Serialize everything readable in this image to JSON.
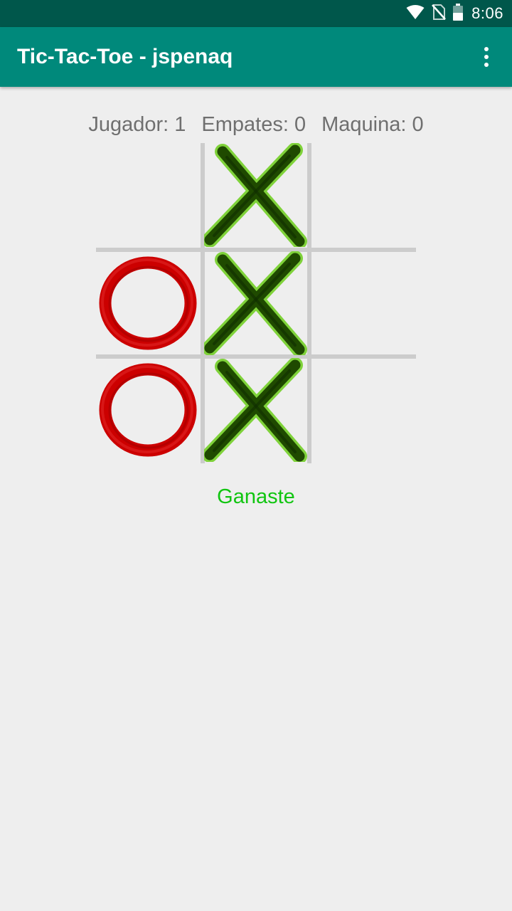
{
  "status_bar": {
    "time": "8:06",
    "icons": [
      "wifi-icon",
      "no-sim-icon",
      "battery-icon"
    ]
  },
  "app_bar": {
    "title": "Tic-Tac-Toe - jspenaq",
    "menu_icon": "more-vert-icon"
  },
  "scores": {
    "player": "Jugador: 1",
    "ties": "Empates: 0",
    "machine": "Maquina: 0"
  },
  "board": {
    "cells": [
      "",
      "X",
      "",
      "O",
      "X",
      "",
      "O",
      "X",
      ""
    ]
  },
  "result": {
    "text": "Ganaste",
    "color": "#11c511"
  },
  "colors": {
    "status_bar": "#00574b",
    "app_bar": "#00897b",
    "background": "#eeeeee",
    "x_mark": "#1f4a00",
    "o_mark": "#cc0000",
    "grid": "#cccccc"
  }
}
